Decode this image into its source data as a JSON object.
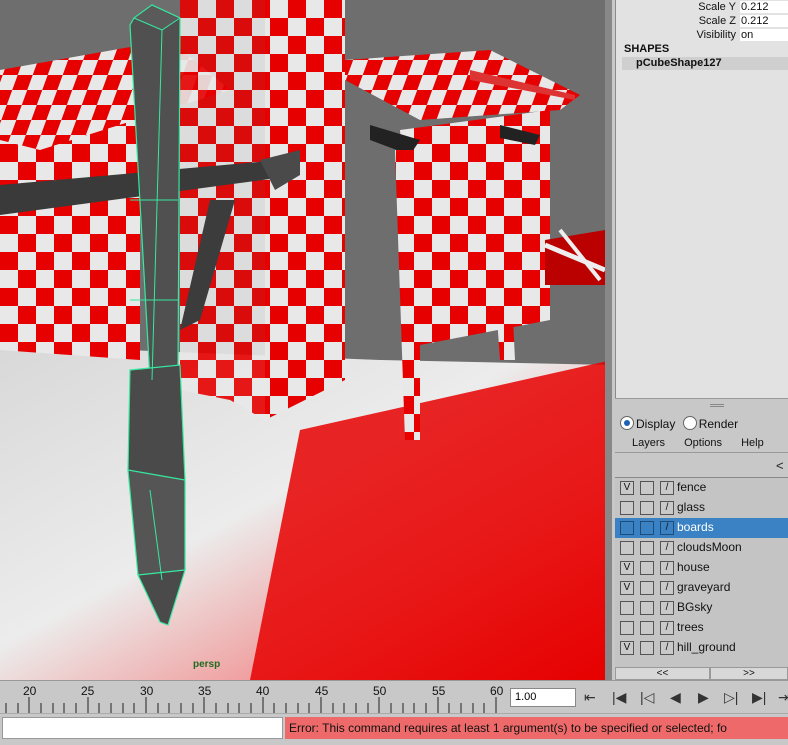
{
  "viewport": {
    "camera_label": "persp"
  },
  "channel_box": {
    "attributes": [
      {
        "label": "Scale Y",
        "value": "0.212"
      },
      {
        "label": "Scale Z",
        "value": "0.212"
      },
      {
        "label": "Visibility",
        "value": "on"
      }
    ],
    "shapes_header": "SHAPES",
    "shape_item": "pCubeShape127"
  },
  "layer_editor": {
    "radio_display": "Display",
    "radio_render": "Render",
    "menu": [
      "Layers",
      "Options",
      "Help"
    ],
    "layers": [
      {
        "name": "fence",
        "visible": "V",
        "selected": false
      },
      {
        "name": "glass",
        "visible": "",
        "selected": false
      },
      {
        "name": "boards",
        "visible": "",
        "selected": true
      },
      {
        "name": "cloudsMoon",
        "visible": "",
        "selected": false
      },
      {
        "name": "house",
        "visible": "V",
        "selected": false
      },
      {
        "name": "graveyard",
        "visible": "V",
        "selected": false
      },
      {
        "name": "BGsky",
        "visible": "",
        "selected": false
      },
      {
        "name": "trees",
        "visible": "",
        "selected": false
      },
      {
        "name": "hill_ground",
        "visible": "V",
        "selected": false
      }
    ],
    "nav_prev": "<<",
    "nav_next": ">>"
  },
  "timeline": {
    "ticks": [
      "20",
      "25",
      "30",
      "35",
      "40",
      "45",
      "50",
      "55",
      "60"
    ],
    "current_frame": "1.00"
  },
  "command_line": {
    "error": "Error: This command requires at least 1 argument(s) to be specified or selected;  fo"
  },
  "colors": {
    "selection": "#3b82c4",
    "error_bg": "#ee6a6a",
    "checker_red": "#e60000"
  }
}
